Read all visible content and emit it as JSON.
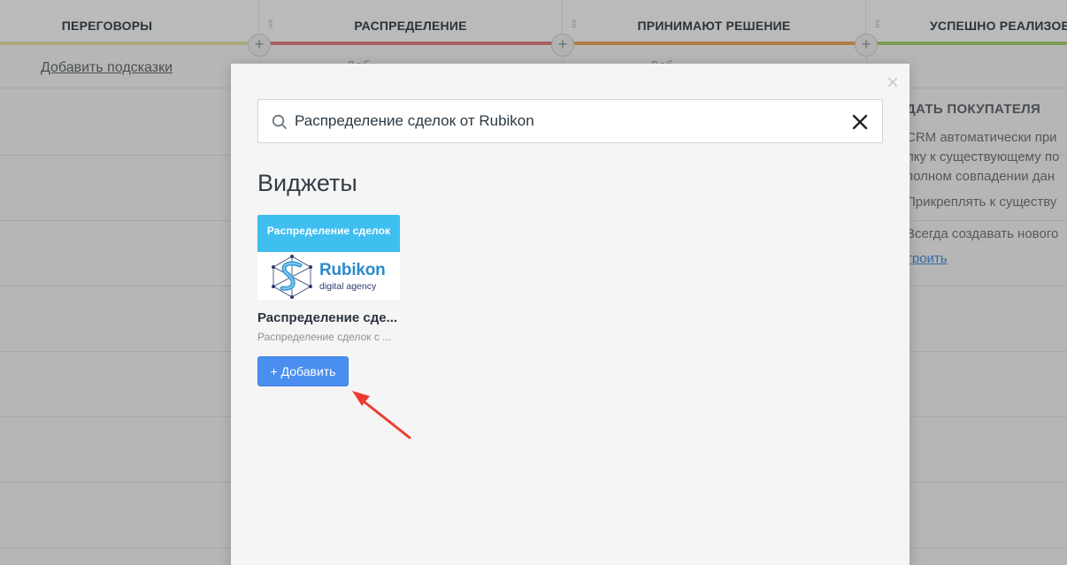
{
  "board": {
    "columns": [
      {
        "title": "ПЕРЕГОВОРЫ",
        "color": "#e8e4a0"
      },
      {
        "title": "РАСПРЕДЕЛЕНИЕ",
        "color": "#e07a78"
      },
      {
        "title": "ПРИНИМАЮТ РЕШЕНИЕ",
        "color": "#f0a656"
      },
      {
        "title": "УСПЕШНО РЕАЛИЗОВ",
        "color": "#a6d36b"
      }
    ],
    "hint_link": "Добавить подсказки",
    "hint_faint_1": "Доб",
    "hint_faint_2": "Доб",
    "side_panel": {
      "title": "ДАТЬ ПОКУПАТЕЛЯ",
      "line1": "CRM автоматически при",
      "line2": "лку к существующему по",
      "line3": "полном совпадении дан",
      "option1": "Прикреплять к существу",
      "option2": "Всегда создавать нового",
      "link": "троить"
    }
  },
  "modal": {
    "search": {
      "value": "Распределение сделок от Rubikon"
    },
    "section_title": "Виджеты",
    "widget": {
      "banner_text": "Распределение сделок",
      "brand_name": "Rubikon",
      "brand_sub": "digital agency",
      "name": "Распределение сде...",
      "description": "Распределение сделок с ...",
      "add_label": "+ Добавить"
    },
    "close_icon": "close-icon"
  },
  "colors": {
    "accent": "#4a8ff0",
    "arrow": "#ee3b2f",
    "banner": "#3fbef0"
  }
}
